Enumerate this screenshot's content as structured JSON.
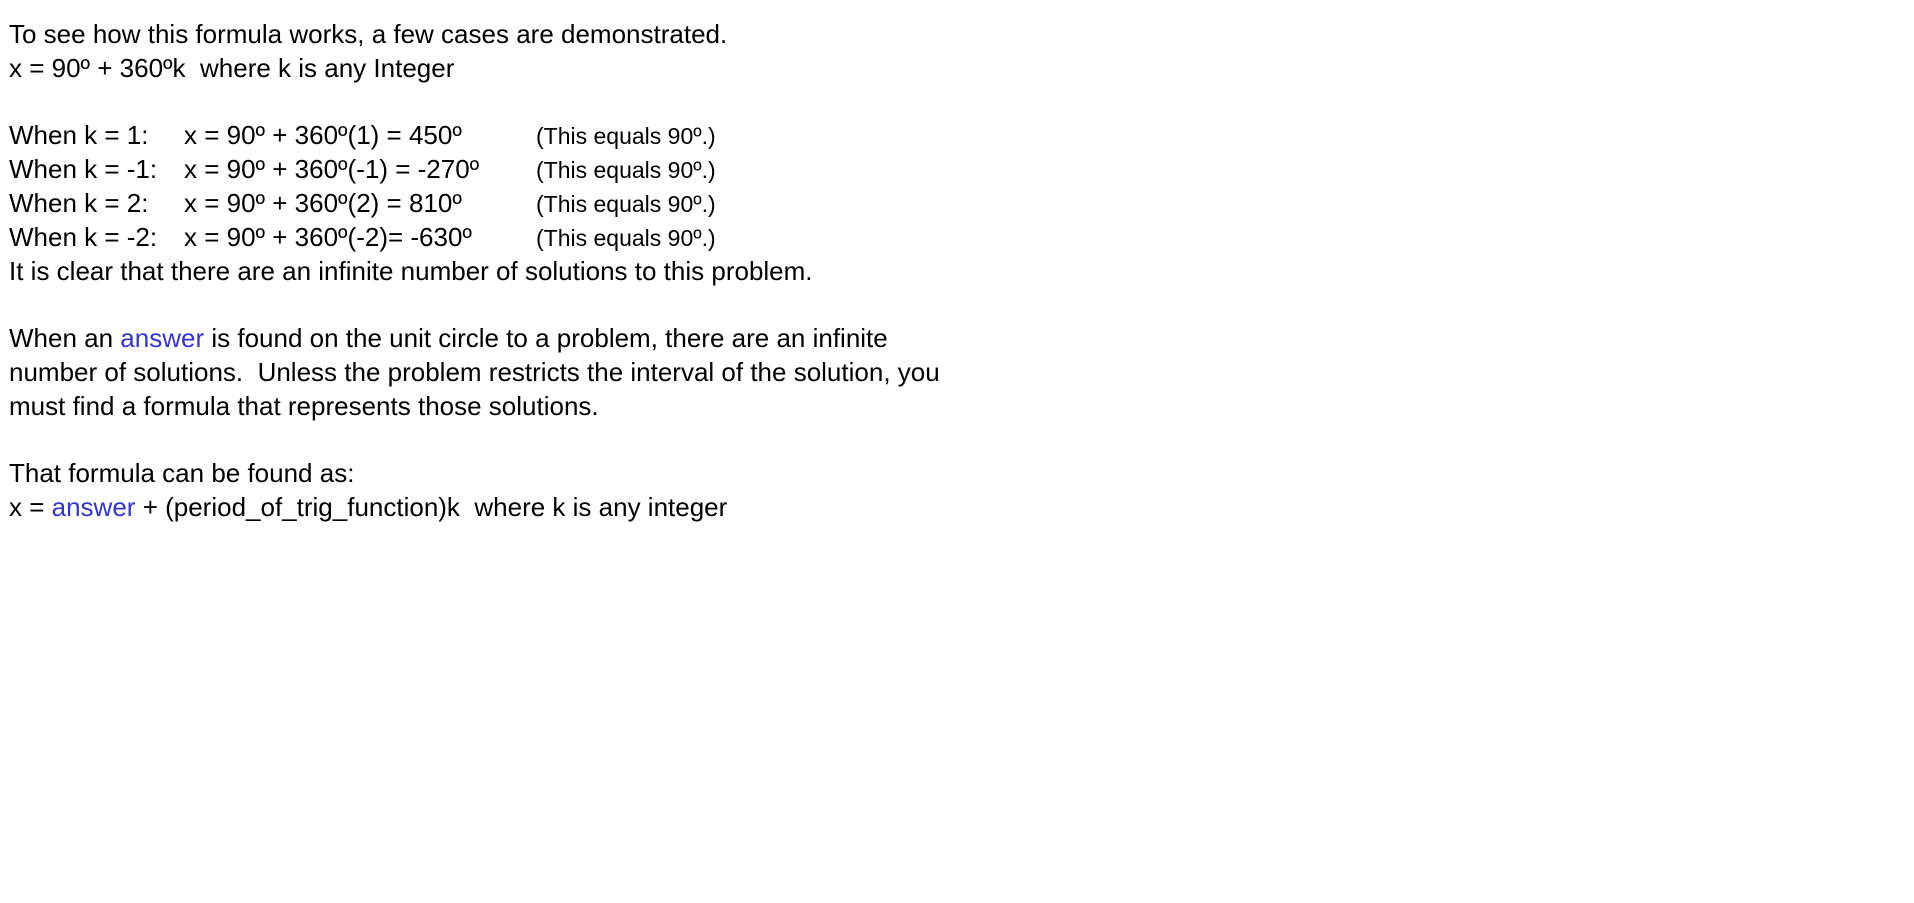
{
  "intro": {
    "line1": "To see how this formula works, a few cases are demonstrated.",
    "line2": "x = 90º + 360ºk  where k is any Integer"
  },
  "cases": [
    {
      "label": "When k = 1:",
      "equation": "x = 90º + 360º(1) = 450º",
      "note": "(This equals 90º.)"
    },
    {
      "label": "When k = -1:",
      "equation": "x = 90º + 360º(-1) = -270º",
      "note": "(This equals 90º.)"
    },
    {
      "label": "When k = 2:",
      "equation": "x = 90º + 360º(2) = 810º",
      "note": "(This equals 90º.)"
    },
    {
      "label": "When k = -2:",
      "equation": "x = 90º + 360º(-2)= -630º",
      "note": "(This equals 90º.)"
    }
  ],
  "conclusion": "It is clear that there are an infinite number of solutions to this problem.",
  "paragraph": {
    "line1_before": "When an ",
    "line1_highlight": "answer",
    "line1_after": " is found on the unit circle to a problem, there are an infinite",
    "line2": "number of solutions.  Unless the problem restricts the interval of the solution, you",
    "line3": "must find a formula that represents those solutions."
  },
  "formula": {
    "intro": "That formula can be found as:",
    "before": "x = ",
    "highlight": "answer",
    "after": " + (period_of_trig_function)k  where k is any integer"
  },
  "colors": {
    "highlight": "#3535c8",
    "text": "#000000",
    "background": "#ffffff"
  }
}
